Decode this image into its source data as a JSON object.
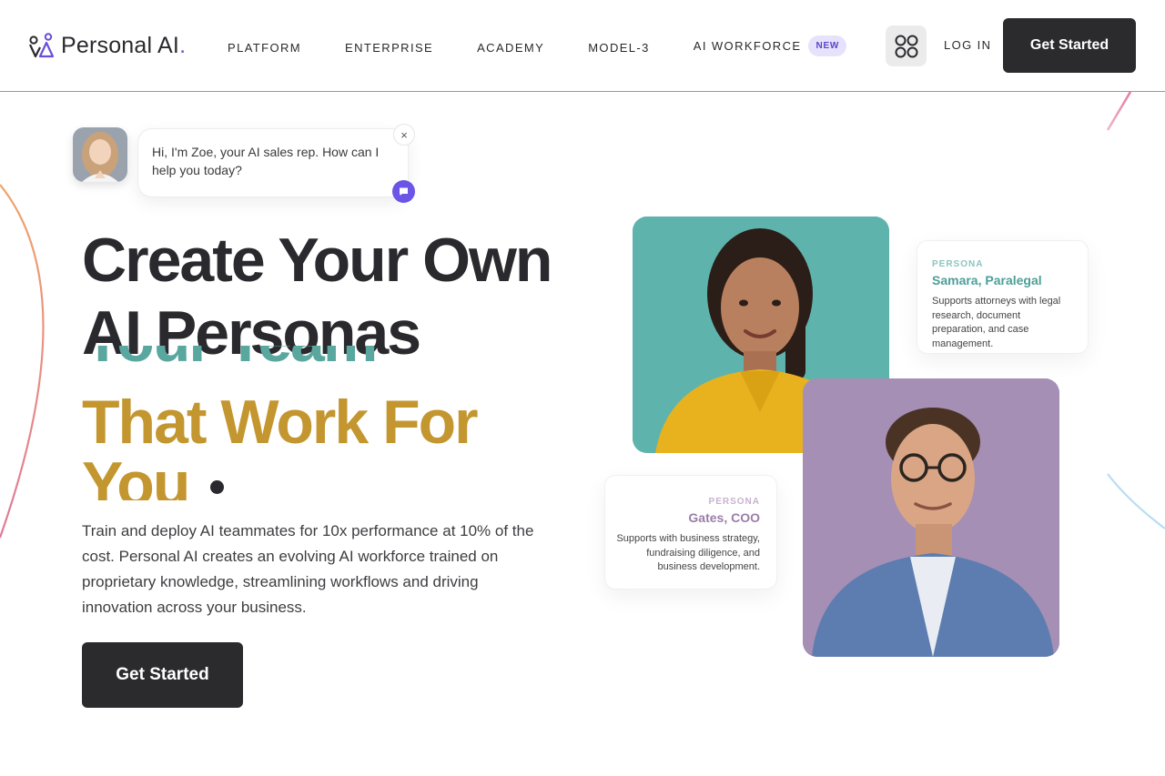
{
  "header": {
    "brand": {
      "name": "Personal AI",
      "dot": "."
    },
    "nav": [
      {
        "label": "PLATFORM"
      },
      {
        "label": "ENTERPRISE"
      },
      {
        "label": "ACADEMY"
      },
      {
        "label": "MODEL-3"
      },
      {
        "label": "AI WORKFORCE",
        "badge": "NEW"
      }
    ],
    "apps_icon": "grid-apps-icon",
    "login_label": "LOG IN",
    "cta_label": "Get Started"
  },
  "chat": {
    "message": "Hi, I'm Zoe, your AI sales rep. How can I help you today?",
    "close_label": "×",
    "icon": "chat-bubble-icon"
  },
  "hero": {
    "headline_line1": "Create Your Own",
    "headline_line2": "AI Personas",
    "rotating_previous": "Your Team",
    "rotating_line1": "That Work For",
    "rotating_line2": "You",
    "description": "Train and deploy AI teammates for 10x performance at 10% of the cost. Personal AI creates an evolving AI workforce trained on proprietary knowledge, streamlining workflows and driving innovation across your business.",
    "cta_label": "Get Started"
  },
  "personas": [
    {
      "label": "PERSONA",
      "name": "Samara, Paralegal",
      "description": "Supports attorneys with legal research, document preparation, and case management."
    },
    {
      "label": "PERSONA",
      "name": "Gates, COO",
      "description": "Supports with business strategy, fundraising diligence, and business development."
    }
  ],
  "colors": {
    "brand_purple": "#6b4fd8",
    "dark_button": "#2b2b2e",
    "teal": "#5aa79f",
    "gold": "#c3962f",
    "mauve": "#9c7daa"
  }
}
